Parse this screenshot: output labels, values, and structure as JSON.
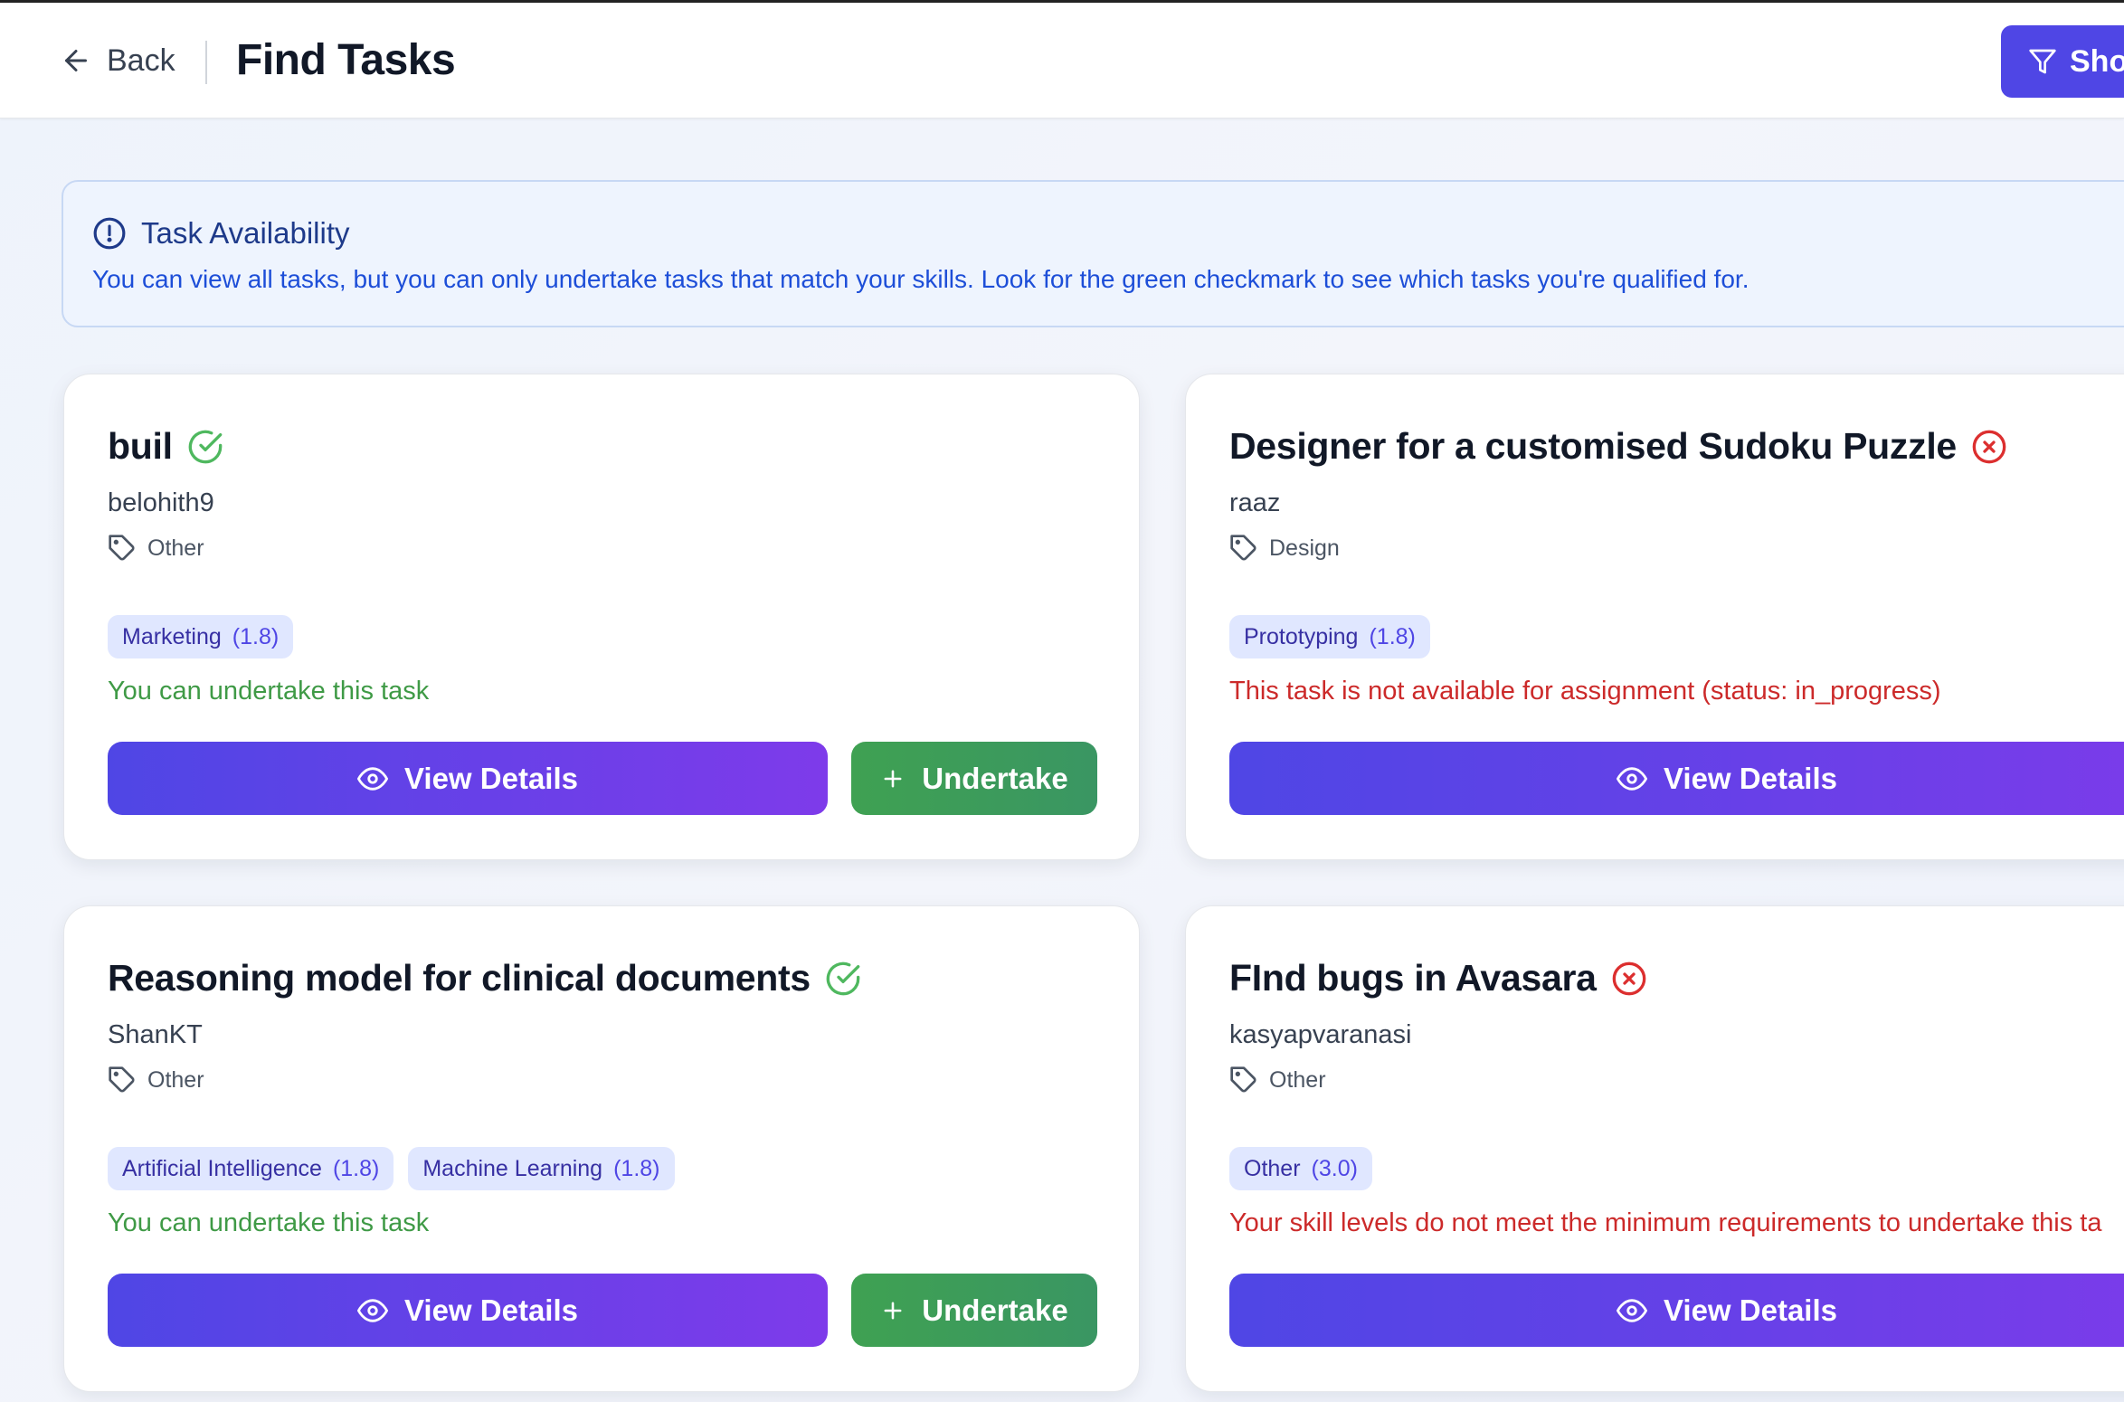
{
  "header": {
    "back_label": "Back",
    "title": "Find Tasks",
    "filter_label": "Sho"
  },
  "info": {
    "title": "Task Availability",
    "text": "You can view all tasks, but you can only undertake tasks that match your skills. Look for the green checkmark to see which tasks you're qualified for."
  },
  "colors": {
    "accent": "#4f46e5",
    "accent_end": "#7e3bea",
    "success": "#3f9a46",
    "error": "#cc2a2a",
    "chip_bg": "#e0e7ff"
  },
  "cards": [
    {
      "title": "buil",
      "status": "qualified",
      "status_icon": "check-circle-icon",
      "author": "belohith9",
      "category": "Other",
      "skills": [
        {
          "name": "Marketing",
          "level": "(1.8)"
        }
      ],
      "message": "You can undertake this task",
      "view_label": "View Details",
      "undertake_label": "Undertake"
    },
    {
      "title": "Designer for a customised Sudoku Puzzle",
      "status": "not-qualified",
      "status_icon": "x-circle-icon",
      "author": "raaz",
      "category": "Design",
      "skills": [
        {
          "name": "Prototyping",
          "level": "(1.8)"
        }
      ],
      "message": "This task is not available for assignment (status: in_progress)",
      "view_label": "View Details"
    },
    {
      "title": "Reasoning model for clinical documents",
      "status": "qualified",
      "status_icon": "check-circle-icon",
      "author": "ShanKT",
      "category": "Other",
      "skills": [
        {
          "name": "Artificial Intelligence",
          "level": "(1.8)"
        },
        {
          "name": "Machine Learning",
          "level": "(1.8)"
        }
      ],
      "message": "You can undertake this task",
      "view_label": "View Details",
      "undertake_label": "Undertake"
    },
    {
      "title": "FInd bugs in Avasara",
      "status": "not-qualified",
      "status_icon": "x-circle-icon",
      "author": "kasyapvaranasi",
      "category": "Other",
      "skills": [
        {
          "name": "Other",
          "level": "(3.0)"
        }
      ],
      "message": "Your skill levels do not meet the minimum requirements to undertake this ta",
      "view_label": "View Details"
    }
  ]
}
